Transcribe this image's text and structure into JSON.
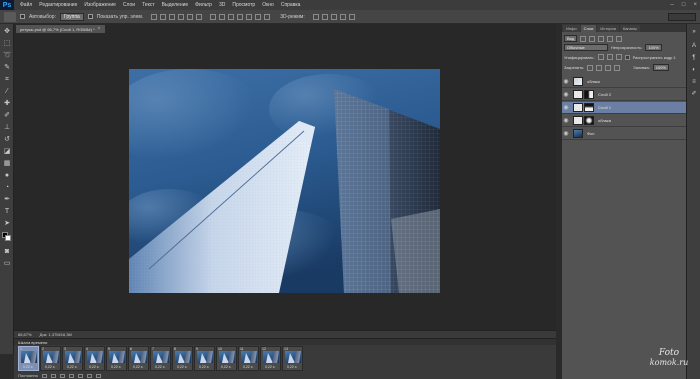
{
  "app": {
    "logo": "Ps"
  },
  "menu": [
    "Файл",
    "Редактирование",
    "Изображение",
    "Слои",
    "Текст",
    "Выделение",
    "Фильтр",
    "3D",
    "Просмотр",
    "Окно",
    "Справка"
  ],
  "window_controls": [
    "–",
    "□",
    "×"
  ],
  "options": {
    "autoselect": "Автовыбор:",
    "autoselect_target": "Группа",
    "show_controls": "Показать упр. элем.",
    "mode_3d": "3D-режим:",
    "workspace": ""
  },
  "document": {
    "tab_title": "ретушь.psd @ 66,7% (Слой 1, RGB/8#) *",
    "close": "×",
    "zoom": "66,67%",
    "doc_info": "Док: 1,37M/16,3M"
  },
  "timeline": {
    "title": "Шкала времени",
    "frames": [
      {
        "num": "1",
        "delay": "0,22 с."
      },
      {
        "num": "2",
        "delay": "0,22 с."
      },
      {
        "num": "3",
        "delay": "0,22 с."
      },
      {
        "num": "4",
        "delay": "0,22 с."
      },
      {
        "num": "5",
        "delay": "0,22 с."
      },
      {
        "num": "6",
        "delay": "0,22 с."
      },
      {
        "num": "7",
        "delay": "0,22 с."
      },
      {
        "num": "8",
        "delay": "0,22 с."
      },
      {
        "num": "9",
        "delay": "0,22 с."
      },
      {
        "num": "10",
        "delay": "0,22 с."
      },
      {
        "num": "11",
        "delay": "0,22 с."
      },
      {
        "num": "12",
        "delay": "0,22 с."
      },
      {
        "num": "13",
        "delay": "0,22 с."
      }
    ],
    "loop": "Постоянно"
  },
  "panels": {
    "tabs": [
      "Инфо",
      "Слои",
      "История",
      "Каналы"
    ],
    "active_tab": "Слои",
    "kind_filter": "Вид",
    "blend_mode": "Обычные",
    "opacity_label": "Непрозрачность:",
    "opacity_value": "100%",
    "unify_label": "Унифицировать:",
    "propagate_label": "Распространить кадр 1",
    "lock_label": "Закрепить:",
    "fill_label": "Заливка:",
    "fill_value": "100%",
    "layers": [
      {
        "name": "облако",
        "selected": false
      },
      {
        "name": "Слой 2",
        "selected": false
      },
      {
        "name": "Слой 1",
        "selected": true
      },
      {
        "name": "облака",
        "selected": false
      },
      {
        "name": "Фон",
        "selected": false
      }
    ]
  },
  "watermark": {
    "line1": "Foto",
    "line2": "komok.ru"
  },
  "colors": {
    "ui_dark": "#2b2b2b",
    "panel": "#535353",
    "selection": "#6b7ea3",
    "sky": "#2a5c94"
  }
}
